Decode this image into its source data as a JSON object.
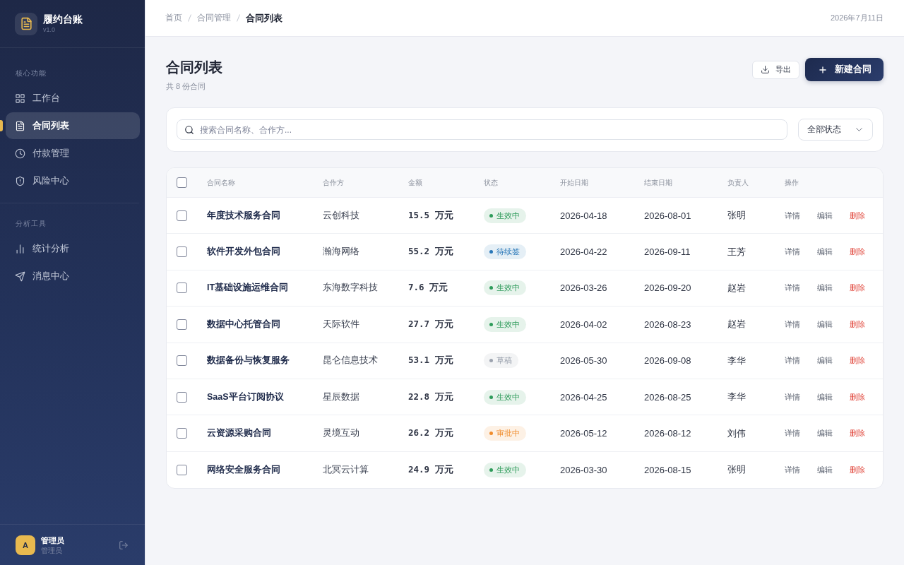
{
  "sidebar": {
    "brand": {
      "title": "履约台账",
      "version": "v1.0"
    },
    "sections": [
      {
        "label": "核心功能",
        "items": [
          {
            "label": "工作台",
            "selected": false
          },
          {
            "label": "合同列表",
            "selected": true
          },
          {
            "label": "付款管理",
            "selected": false
          },
          {
            "label": "风险中心",
            "selected": false
          }
        ]
      },
      {
        "label": "分析工具",
        "items": [
          {
            "label": "统计分析",
            "selected": false
          },
          {
            "label": "消息中心",
            "selected": false
          }
        ]
      }
    ],
    "user": {
      "avatar_letter": "A",
      "name": "管理员",
      "role": "管理员"
    }
  },
  "header": {
    "breadcrumb": [
      {
        "label": "首页",
        "current": false
      },
      {
        "label": "合同管理",
        "current": false
      },
      {
        "label": "合同列表",
        "current": true
      }
    ],
    "date": "2026年7月11日"
  },
  "page": {
    "title": "合同列表",
    "subtitle": "共 8 份合同",
    "actions": [
      {
        "label": "导出",
        "kind": "secondary"
      },
      {
        "label": "新建合同",
        "kind": "primary"
      }
    ]
  },
  "filters": {
    "search": {
      "placeholder": "搜索合同名称、合作方..."
    },
    "status_select": {
      "value": "全部状态"
    }
  },
  "table": {
    "select_all": {
      "checked": false
    },
    "columns": [
      "合同名称",
      "合作方",
      "金额",
      "状态",
      "开始日期",
      "结束日期",
      "负责人",
      "操作"
    ],
    "rows": [
      {
        "checked": false,
        "name": "年度技术服务合同",
        "partner": "云创科技",
        "amount": "15.5 万元",
        "status": {
          "label": "生效中",
          "color": "#2e9b5a"
        },
        "start": "2026-04-18",
        "end": "2026-08-01",
        "owner": "张明",
        "actions": [
          {
            "label": "详情",
            "kind": "view"
          },
          {
            "label": "编辑",
            "kind": "edit"
          },
          {
            "label": "删除",
            "kind": "delete"
          }
        ]
      },
      {
        "checked": false,
        "name": "软件开发外包合同",
        "partner": "瀚海网络",
        "amount": "55.2 万元",
        "status": {
          "label": "待续签",
          "color": "#2a78b8"
        },
        "start": "2026-04-22",
        "end": "2026-09-11",
        "owner": "王芳",
        "actions": [
          {
            "label": "详情",
            "kind": "view"
          },
          {
            "label": "编辑",
            "kind": "edit"
          },
          {
            "label": "删除",
            "kind": "delete"
          }
        ]
      },
      {
        "checked": false,
        "name": "IT基础设施运维合同",
        "partner": "东海数字科技",
        "amount": "7.6 万元",
        "status": {
          "label": "生效中",
          "color": "#2e9b5a"
        },
        "start": "2026-03-26",
        "end": "2026-09-20",
        "owner": "赵岩",
        "actions": [
          {
            "label": "详情",
            "kind": "view"
          },
          {
            "label": "编辑",
            "kind": "edit"
          },
          {
            "label": "删除",
            "kind": "delete"
          }
        ]
      },
      {
        "checked": false,
        "name": "数据中心托管合同",
        "partner": "天际软件",
        "amount": "27.7 万元",
        "status": {
          "label": "生效中",
          "color": "#2e9b5a"
        },
        "start": "2026-04-02",
        "end": "2026-08-23",
        "owner": "赵岩",
        "actions": [
          {
            "label": "详情",
            "kind": "view"
          },
          {
            "label": "编辑",
            "kind": "edit"
          },
          {
            "label": "删除",
            "kind": "delete"
          }
        ]
      },
      {
        "checked": false,
        "name": "数据备份与恢复服务",
        "partner": "昆仑信息技术",
        "amount": "53.1 万元",
        "status": {
          "label": "草稿",
          "color": "#9ca3af"
        },
        "start": "2026-05-30",
        "end": "2026-09-08",
        "owner": "李华",
        "actions": [
          {
            "label": "详情",
            "kind": "view"
          },
          {
            "label": "编辑",
            "kind": "edit"
          },
          {
            "label": "删除",
            "kind": "delete"
          }
        ]
      },
      {
        "checked": false,
        "name": "SaaS平台订阅协议",
        "partner": "星辰数据",
        "amount": "22.8 万元",
        "status": {
          "label": "生效中",
          "color": "#2e9b5a"
        },
        "start": "2026-04-25",
        "end": "2026-08-25",
        "owner": "李华",
        "actions": [
          {
            "label": "详情",
            "kind": "view"
          },
          {
            "label": "编辑",
            "kind": "edit"
          },
          {
            "label": "删除",
            "kind": "delete"
          }
        ]
      },
      {
        "checked": false,
        "name": "云资源采购合同",
        "partner": "灵境互动",
        "amount": "26.2 万元",
        "status": {
          "label": "审批中",
          "color": "#f08c2c"
        },
        "start": "2026-05-12",
        "end": "2026-08-12",
        "owner": "刘伟",
        "actions": [
          {
            "label": "详情",
            "kind": "view"
          },
          {
            "label": "编辑",
            "kind": "edit"
          },
          {
            "label": "删除",
            "kind": "delete"
          }
        ]
      },
      {
        "checked": false,
        "name": "网络安全服务合同",
        "partner": "北冥云计算",
        "amount": "24.9 万元",
        "status": {
          "label": "生效中",
          "color": "#2e9b5a"
        },
        "start": "2026-03-30",
        "end": "2026-08-15",
        "owner": "张明",
        "actions": [
          {
            "label": "详情",
            "kind": "view"
          },
          {
            "label": "编辑",
            "kind": "edit"
          },
          {
            "label": "删除",
            "kind": "delete"
          }
        ]
      }
    ]
  }
}
